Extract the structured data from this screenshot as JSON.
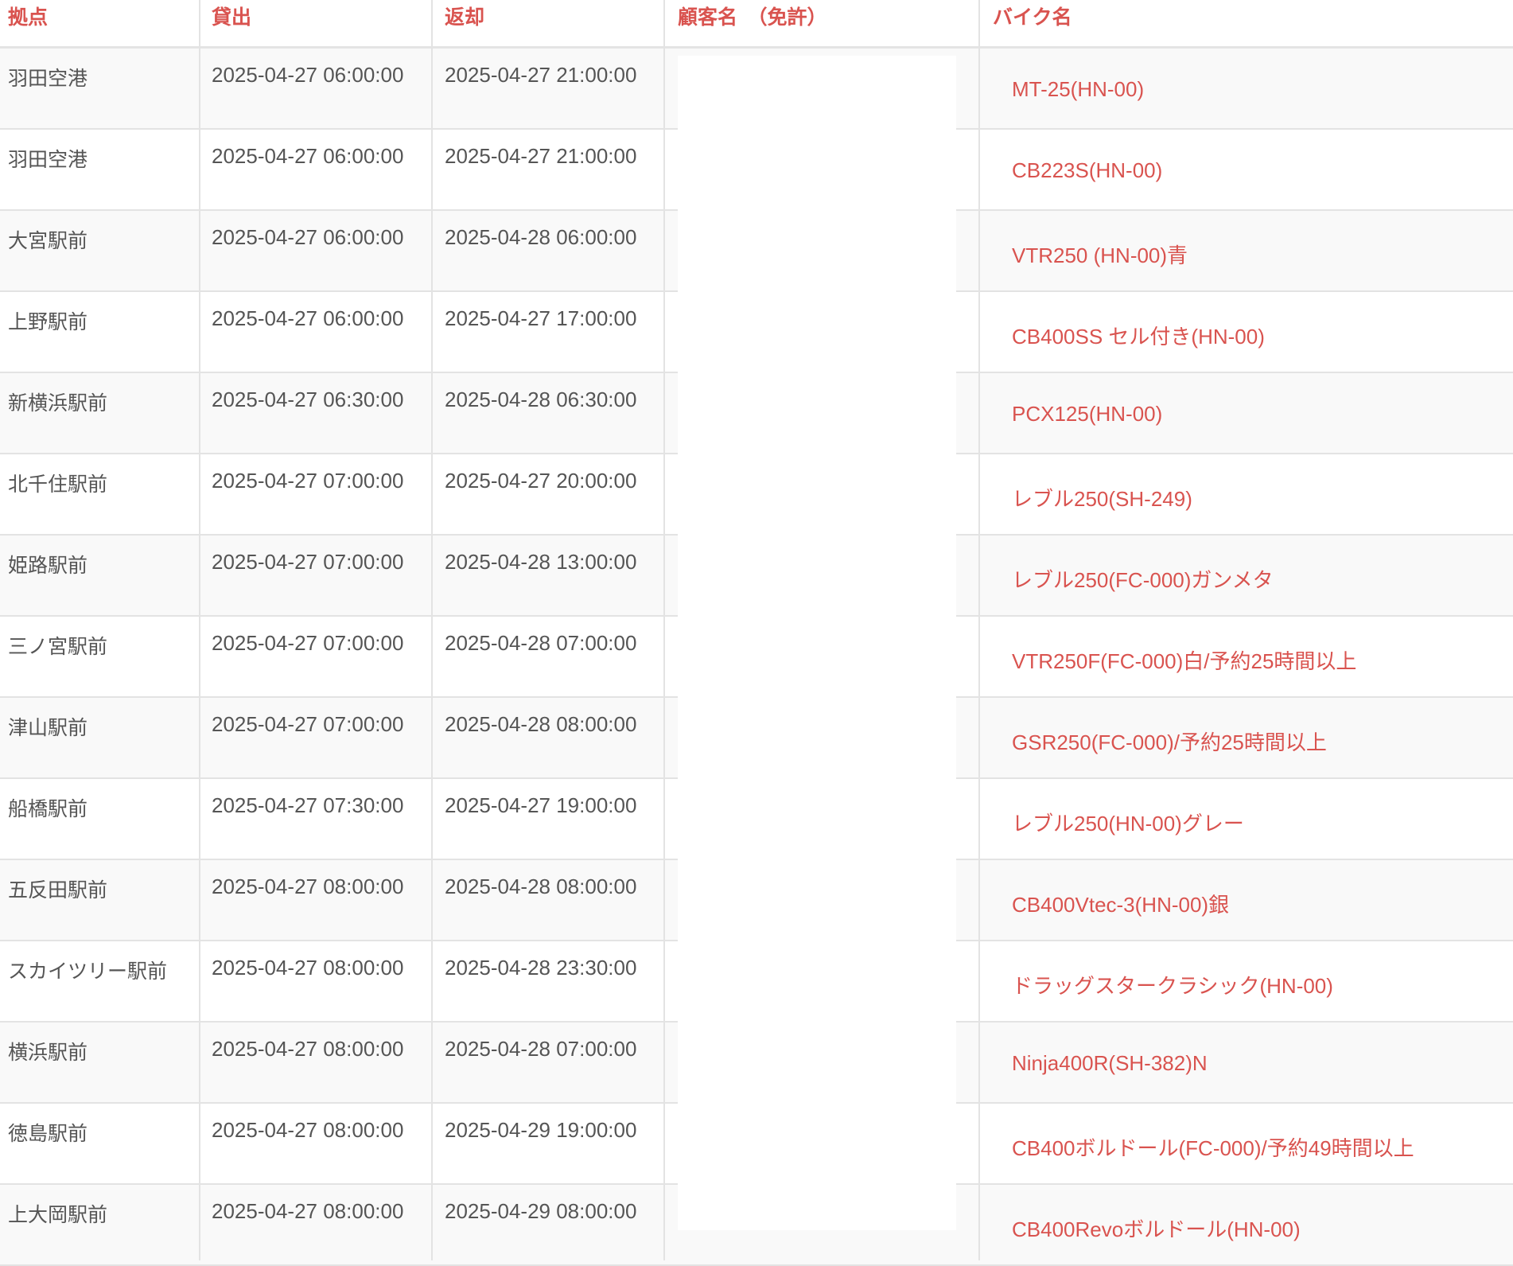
{
  "columns": {
    "kyoten": "拠点",
    "kashidashi": "貸出",
    "henkyaku": "返却",
    "customer": "顧客名　（免許）",
    "bike": "バイク名"
  },
  "rows": [
    {
      "kyoten": "羽田空港",
      "kashidashi": "2025-04-27 06:00:00",
      "henkyaku": "2025-04-27 21:00:00",
      "bike": "MT-25(HN-00)"
    },
    {
      "kyoten": "羽田空港",
      "kashidashi": "2025-04-27 06:00:00",
      "henkyaku": "2025-04-27 21:00:00",
      "bike": "CB223S(HN-00)"
    },
    {
      "kyoten": "大宮駅前",
      "kashidashi": "2025-04-27 06:00:00",
      "henkyaku": "2025-04-28 06:00:00",
      "bike": "VTR250 (HN-00)青"
    },
    {
      "kyoten": "上野駅前",
      "kashidashi": "2025-04-27 06:00:00",
      "henkyaku": "2025-04-27 17:00:00",
      "bike": "CB400SS セル付き(HN-00)"
    },
    {
      "kyoten": "新横浜駅前",
      "kashidashi": "2025-04-27 06:30:00",
      "henkyaku": "2025-04-28 06:30:00",
      "bike": "PCX125(HN-00)"
    },
    {
      "kyoten": "北千住駅前",
      "kashidashi": "2025-04-27 07:00:00",
      "henkyaku": "2025-04-27 20:00:00",
      "bike": "レブル250(SH-249)"
    },
    {
      "kyoten": "姫路駅前",
      "kashidashi": "2025-04-27 07:00:00",
      "henkyaku": "2025-04-28 13:00:00",
      "bike": "レブル250(FC-000)ガンメタ"
    },
    {
      "kyoten": "三ノ宮駅前",
      "kashidashi": "2025-04-27 07:00:00",
      "henkyaku": "2025-04-28 07:00:00",
      "bike": "VTR250F(FC-000)白/予約25時間以上"
    },
    {
      "kyoten": "津山駅前",
      "kashidashi": "2025-04-27 07:00:00",
      "henkyaku": "2025-04-28 08:00:00",
      "bike": "GSR250(FC-000)/予約25時間以上"
    },
    {
      "kyoten": "船橋駅前",
      "kashidashi": "2025-04-27 07:30:00",
      "henkyaku": "2025-04-27 19:00:00",
      "bike": "レブル250(HN-00)グレー"
    },
    {
      "kyoten": "五反田駅前",
      "kashidashi": "2025-04-27 08:00:00",
      "henkyaku": "2025-04-28 08:00:00",
      "bike": "CB400Vtec-3(HN-00)銀"
    },
    {
      "kyoten": "スカイツリー駅前",
      "kashidashi": "2025-04-27 08:00:00",
      "henkyaku": "2025-04-28 23:30:00",
      "bike": "ドラッグスタークラシック(HN-00)"
    },
    {
      "kyoten": "横浜駅前",
      "kashidashi": "2025-04-27 08:00:00",
      "henkyaku": "2025-04-28 07:00:00",
      "bike": "Ninja400R(SH-382)N"
    },
    {
      "kyoten": "徳島駅前",
      "kashidashi": "2025-04-27 08:00:00",
      "henkyaku": "2025-04-29 19:00:00",
      "bike": "CB400ボルドール(FC-000)/予約49時間以上"
    },
    {
      "kyoten": "上大岡駅前",
      "kashidashi": "2025-04-27 08:00:00",
      "henkyaku": "2025-04-29 08:00:00",
      "bike": "CB400Revoボルドール(HN-00)"
    }
  ],
  "colors": {
    "accent": "#d9534f",
    "text": "#555555",
    "row_stripe": "#f9f9f9",
    "border": "#e3e3e3"
  }
}
